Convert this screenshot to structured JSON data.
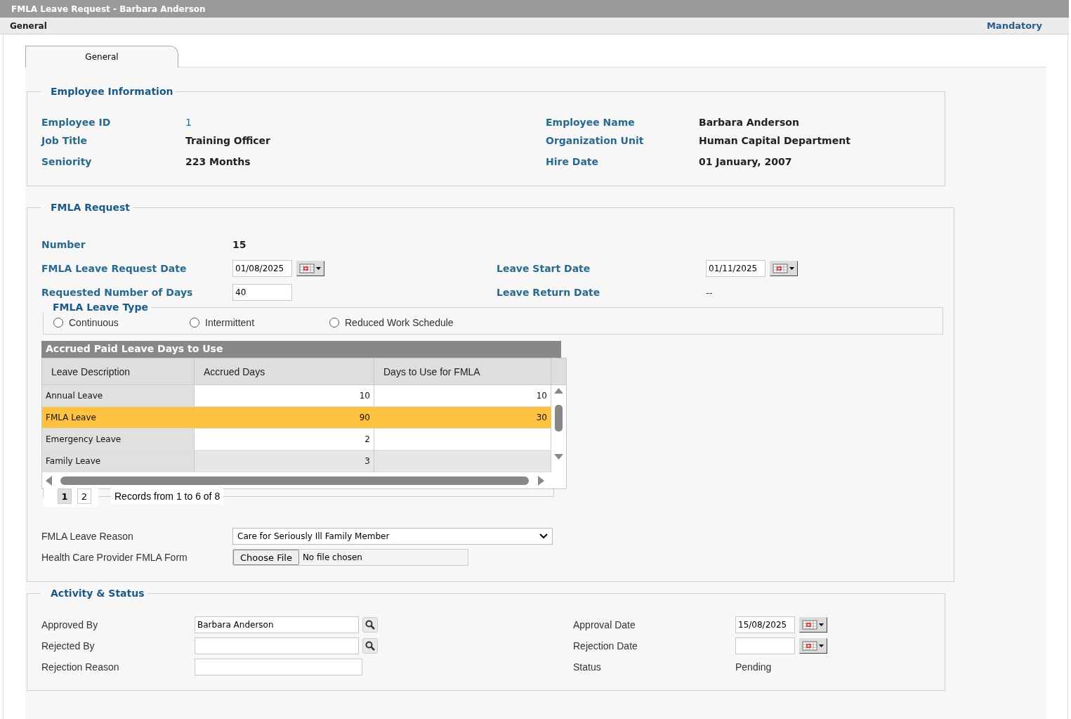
{
  "window": {
    "title": "FMLA Leave Request - Barbara Anderson"
  },
  "subheader": {
    "section": "General",
    "mandatory": "Mandatory"
  },
  "tabs": [
    {
      "label": "General",
      "selected": true
    }
  ],
  "employee_information": {
    "title": "Employee Information",
    "fields": [
      {
        "label": "Employee ID",
        "value": "1",
        "kind": "link"
      },
      {
        "label": "Employee Name",
        "value": "Barbara Anderson",
        "kind": "text"
      },
      {
        "label": "Job Title",
        "value": "Training Officer",
        "kind": "text"
      },
      {
        "label": "Organization Unit",
        "value": "Human Capital Department",
        "kind": "text"
      },
      {
        "label": "Seniority",
        "value": "223 Months",
        "kind": "text"
      },
      {
        "label": "Hire Date",
        "value": "01 January, 2007",
        "kind": "text"
      }
    ]
  },
  "fmla_request": {
    "title": "FMLA Request",
    "fields": [
      {
        "label": "Number",
        "value": "15",
        "kind": "text"
      },
      {
        "kind": "empty"
      },
      {
        "label": "FMLA Leave Request Date",
        "value": "01/08/2025",
        "kind": "date"
      },
      {
        "label": "Leave Start Date",
        "value": "01/11/2025",
        "kind": "date"
      },
      {
        "label": "Requested Number of Days",
        "value": "40",
        "kind": "input"
      },
      {
        "label": "Leave Return Date",
        "value": "--",
        "kind": "plain"
      }
    ],
    "leave_type": {
      "title": "FMLA Leave Type",
      "options": [
        {
          "label": "Continuous",
          "selected": false
        },
        {
          "label": "Intermittent",
          "selected": false
        },
        {
          "label": "Reduced Work Schedule",
          "selected": false
        }
      ]
    },
    "accrued_table": {
      "title": "Accrued Paid Leave Days to Use",
      "columns": [
        "Leave Description",
        "Accrued Days",
        "Days to Use for FMLA"
      ],
      "rows": [
        {
          "cells": [
            "Annual Leave",
            "10",
            "10"
          ],
          "selected": false
        },
        {
          "cells": [
            "FMLA Leave",
            "90",
            "30"
          ],
          "selected": true
        },
        {
          "cells": [
            "Emergency Leave",
            "2",
            ""
          ],
          "selected": false
        },
        {
          "cells": [
            "Family Leave",
            "3",
            ""
          ],
          "selected": false
        }
      ],
      "pages": [
        {
          "label": "1",
          "selected": true
        },
        {
          "label": "2",
          "selected": false
        }
      ],
      "records": "Records from 1 to 6 of 8"
    },
    "reason": {
      "label": "FMLA Leave Reason",
      "value": "Care for Seriously Ill Family Member"
    },
    "form_upload": {
      "label": "Health Care Provider FMLA Form",
      "button": "Choose File",
      "status": "No file chosen"
    }
  },
  "activity_status": {
    "title": "Activity & Status",
    "fields": [
      {
        "label": "Approved By",
        "value": "Barbara Anderson",
        "kind": "lookup"
      },
      {
        "label": "Approval Date",
        "value": "15/08/2025",
        "kind": "date"
      },
      {
        "label": "Rejected By",
        "kind": "lookup"
      },
      {
        "label": "Rejection Date",
        "kind": "date"
      },
      {
        "label": "Rejection Reason",
        "kind": "input"
      },
      {
        "label": "Status",
        "value": "Pending",
        "kind": "plain"
      }
    ]
  }
}
